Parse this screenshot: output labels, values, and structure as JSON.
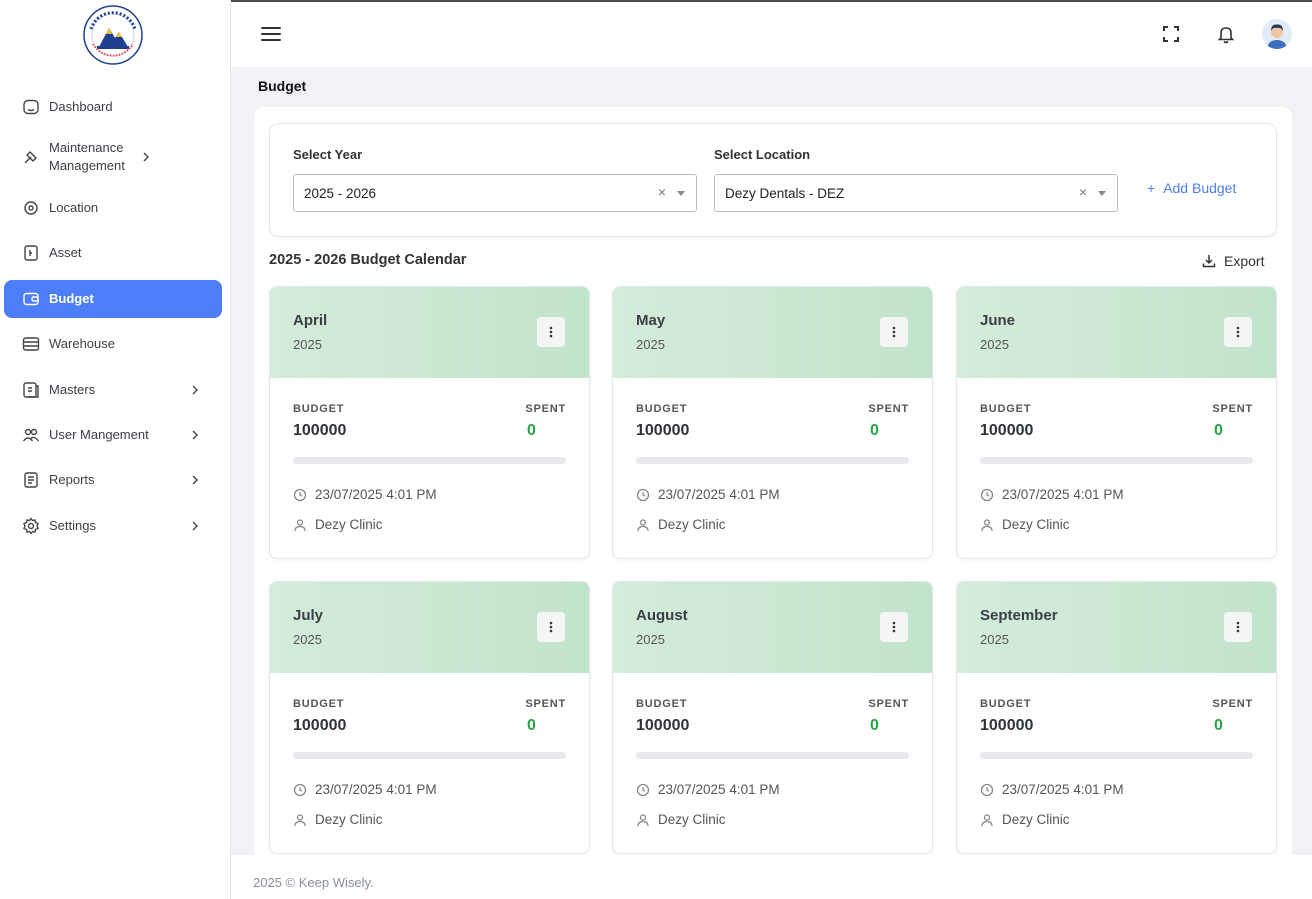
{
  "app": {
    "name": "KEEP WISELY",
    "tagline": "BUILT TO MANAGE EVERYTHING"
  },
  "sidebar": {
    "items": [
      {
        "label": "Dashboard",
        "icon": "dashboard-icon",
        "chevron": false
      },
      {
        "label": "Maintenance Management",
        "icon": "wrench-icon",
        "chevron": true
      },
      {
        "label": "Location",
        "icon": "location-icon",
        "chevron": false
      },
      {
        "label": "Asset",
        "icon": "asset-icon",
        "chevron": false
      },
      {
        "label": "Budget",
        "icon": "wallet-icon",
        "chevron": false,
        "active": true
      },
      {
        "label": "Warehouse",
        "icon": "warehouse-icon",
        "chevron": false
      },
      {
        "label": "Masters",
        "icon": "masters-icon",
        "chevron": true
      },
      {
        "label": "User Mangement",
        "icon": "users-icon",
        "chevron": true
      },
      {
        "label": "Reports",
        "icon": "reports-icon",
        "chevron": true
      },
      {
        "label": "Settings",
        "icon": "gear-icon",
        "chevron": true
      }
    ]
  },
  "page": {
    "title": "Budget"
  },
  "filters": {
    "year_label": "Select Year",
    "year_value": "2025 - 2026",
    "location_label": "Select Location",
    "location_value": "Dezy Dentals - DEZ",
    "clear_symbol": "×",
    "add_budget": "Add Budget",
    "add_symbol": "+"
  },
  "calendar": {
    "title": "2025 - 2026 Budget Calendar",
    "export_label": "Export",
    "budget_label": "BUDGET",
    "spent_label": "SPENT",
    "cards": [
      {
        "month": "April",
        "year": "2025",
        "budget": "100000",
        "spent": "0",
        "progress": 0,
        "updated": "23/07/2025 4:01 PM",
        "user": "Dezy Clinic"
      },
      {
        "month": "May",
        "year": "2025",
        "budget": "100000",
        "spent": "0",
        "progress": 0,
        "updated": "23/07/2025 4:01 PM",
        "user": "Dezy Clinic"
      },
      {
        "month": "June",
        "year": "2025",
        "budget": "100000",
        "spent": "0",
        "progress": 0,
        "updated": "23/07/2025 4:01 PM",
        "user": "Dezy Clinic"
      },
      {
        "month": "July",
        "year": "2025",
        "budget": "100000",
        "spent": "0",
        "progress": 0,
        "updated": "23/07/2025 4:01 PM",
        "user": "Dezy Clinic"
      },
      {
        "month": "August",
        "year": "2025",
        "budget": "100000",
        "spent": "0",
        "progress": 0,
        "updated": "23/07/2025 4:01 PM",
        "user": "Dezy Clinic"
      },
      {
        "month": "September",
        "year": "2025",
        "budget": "100000",
        "spent": "0",
        "progress": 0,
        "updated": "23/07/2025 4:01 PM",
        "user": "Dezy Clinic"
      }
    ]
  },
  "footer": {
    "text": "2025 © Keep Wisely."
  },
  "colors": {
    "accent": "#4d7ef7",
    "card_header": "#cfe9d6",
    "spent": "#28a745"
  }
}
